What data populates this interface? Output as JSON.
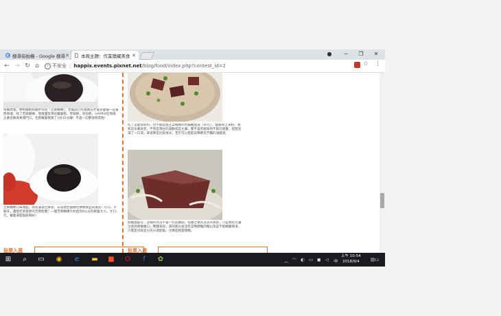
{
  "browser": {
    "tabs": [
      {
        "label": "搜尋街拍機 - Google 搜尋",
        "active": false
      },
      {
        "label": "本周主題：作業隱藏美食",
        "active": true
      }
    ],
    "url": {
      "security_label": "不安全",
      "host": "happix.events.pixnet.net",
      "path": "/blog/food/index.php?contest_id=2"
    },
    "window_controls": {
      "minimize": "─",
      "maximize": "❐",
      "close": "✕"
    }
  },
  "articles": {
    "left": [
      {
        "caption": "荷嫩玫瑰，便把麵粉和麵手作的「芝麻糊裸」，老闆說只有我兩夫才會多麼嚐一些東西來嚐，除了芝麻糊裸，現燒還有港式蘿蔔糕，芋頭餅，馬拉糕，HAPPIX在現場立著名蘇菲真偶門口，在那蘿蔔糕買了1份35分鐘！不過一切都很值得啦！"
      },
      {
        "caption": "芝麻糊裸口味微甜，帶有濃濃芝麻香，非常適合喜歡吃裸類食品的朋友！Q Q，不黏牙，還能吃到香醇的芝麻粒喔！一個芝麻糊裸大約直徑8公分的碗盤大小，才15元，蘿蔔湯超點殿喝好！"
      }
    ],
    "right": [
      {
        "caption": "吃了這麼多好料，也不能錯過王菜鴨脾的大腸豬血湯（40元），配飯和上米粉，我和這份著很足，不管是現台的湯動或是大腸，都不會有腥味和不乾的感覺，搭配充滿了一口湯，味道算是比較清淡，至於可以搭配菜鴨脾及芥醬的油膩感。"
      },
      {
        "caption": "而豬血部分，這裡的作法不會一吃就散開，咀嚼之後有淡淡的香氣，只是偶吃可讓注意到香嫩嫩口，整體來說，湯的部分並沒有菜鴨脾麵肉麵以及是不能豬麗微道，只需是也就是分充分適配角，也算是相當順暢。"
      }
    ],
    "vote_label": "投票入選"
  },
  "taskbar": {
    "time": "上午 10:54",
    "date": "2018/9/4",
    "notifications": "13"
  }
}
